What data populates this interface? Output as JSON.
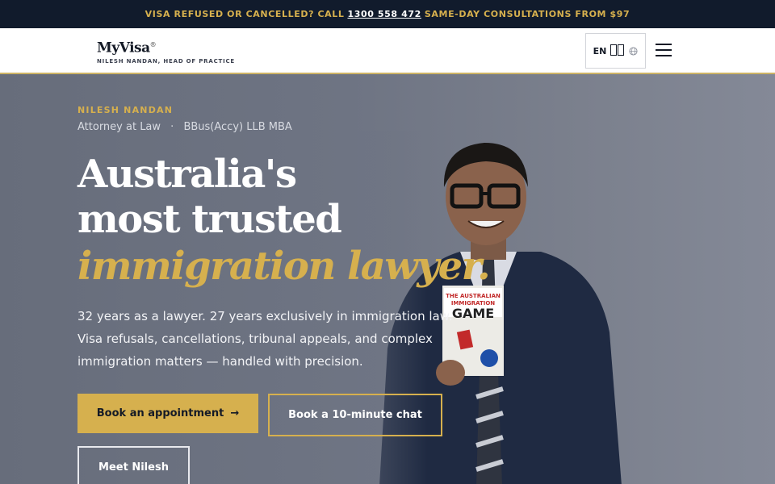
{
  "topbar": {
    "prefix": "VISA REFUSED OR CANCELLED? CALL",
    "phone": "1300 558 472",
    "suffix": "SAME-DAY CONSULTATIONS FROM $97"
  },
  "header": {
    "brand_name": "MyVisa",
    "brand_mark": "®",
    "brand_sub": "NILESH NANDAN, HEAD OF PRACTICE",
    "lang_code": "EN",
    "icons": [
      "globe-icon",
      "menu-icon"
    ]
  },
  "hero": {
    "eyebrow": "NILESH NANDAN",
    "role": "Attorney at Law",
    "separator": "·",
    "degrees": "BBus(Accy) LLB MBA",
    "headline_1": "Australia's",
    "headline_2": "most trusted",
    "headline_accent": "immigration lawyer.",
    "lede": "32 years as a lawyer. 27 years exclusively in immigration law. Visa refusals, cancellations, tribunal appeals, and complex immigration matters — handled with precision.",
    "book_label": "Book the Australian Immigration Game",
    "book_title": "THE AUSTRALIAN IMMIGRATION GAME"
  },
  "actions": {
    "primary": "Book an appointment",
    "primary_arrow": "→",
    "outline": "Book a 10-minute chat",
    "ghost": "Meet Nilesh"
  },
  "colors": {
    "accent": "#d6b04e",
    "topbar_bg": "#111b2c",
    "hero_bg": "#6e7482"
  }
}
